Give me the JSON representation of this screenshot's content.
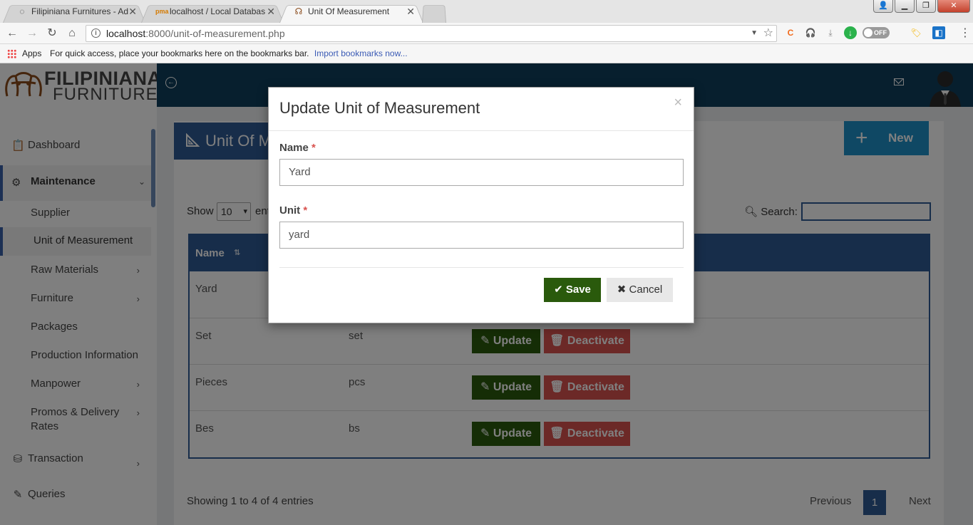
{
  "browser": {
    "tabs": [
      {
        "title": "Filipiniana Furnitures - Ad",
        "active": false
      },
      {
        "title": "localhost / Local Databas",
        "active": false
      },
      {
        "title": "Unit Of Measurement",
        "active": true
      }
    ],
    "url_host": "localhost",
    "url_path": ":8000/unit-of-measurement.php",
    "toggle_label": "OFF",
    "bookmarks": {
      "apps_label": "Apps",
      "hint": "For quick access, place your bookmarks here on the bookmarks bar.",
      "import_link": "Import bookmarks now..."
    }
  },
  "brand": {
    "line1": "FILIPINIANA",
    "line2": "FURNITURE"
  },
  "sidebar": {
    "dashboard": "Dashboard",
    "maintenance": "Maintenance",
    "sub": {
      "supplier": "Supplier",
      "unit": "Unit of Measurement",
      "raw": "Raw Materials",
      "furniture": "Furniture",
      "packages": "Packages",
      "production": "Production Information",
      "manpower": "Manpower",
      "promos1": "Promos & Delivery",
      "promos2": "Rates"
    },
    "transaction": "Transaction",
    "queries": "Queries"
  },
  "page": {
    "title": "Unit Of M",
    "new_button": "New",
    "show_label": "Show",
    "page_length": "10",
    "entries_label": "ent",
    "search_label": "Search:",
    "search_value": "",
    "col_name": "Name",
    "update_label": "Update",
    "deactivate_label": "Deactivate",
    "rows": [
      {
        "name": "Yard",
        "unit": ""
      },
      {
        "name": "Set",
        "unit": "set"
      },
      {
        "name": "Pieces",
        "unit": "pcs"
      },
      {
        "name": "Bes",
        "unit": "bs"
      }
    ],
    "info": "Showing 1 to 4 of 4 entries",
    "pager": {
      "prev": "Previous",
      "current": "1",
      "next": "Next"
    }
  },
  "modal": {
    "title": "Update Unit of Measurement",
    "close_glyph": "×",
    "name_label": "Name",
    "name_value": "Yard",
    "unit_label": "Unit",
    "unit_value": "yard",
    "required_mark": "*",
    "save_label": "Save",
    "cancel_label": "Cancel"
  },
  "colors": {
    "topbar": "#0f3e5c",
    "primary": "#2f5a95",
    "new_button": "#1e90c9",
    "update_button": "#2a5a0c",
    "deactivate_button": "#d9534f"
  },
  "icons": {
    "back": "arrow-left-icon",
    "forward": "arrow-right-icon",
    "reload": "reload-icon",
    "home": "home-icon",
    "star": "star-icon",
    "mail": "envelope-icon",
    "search": "search-icon"
  }
}
